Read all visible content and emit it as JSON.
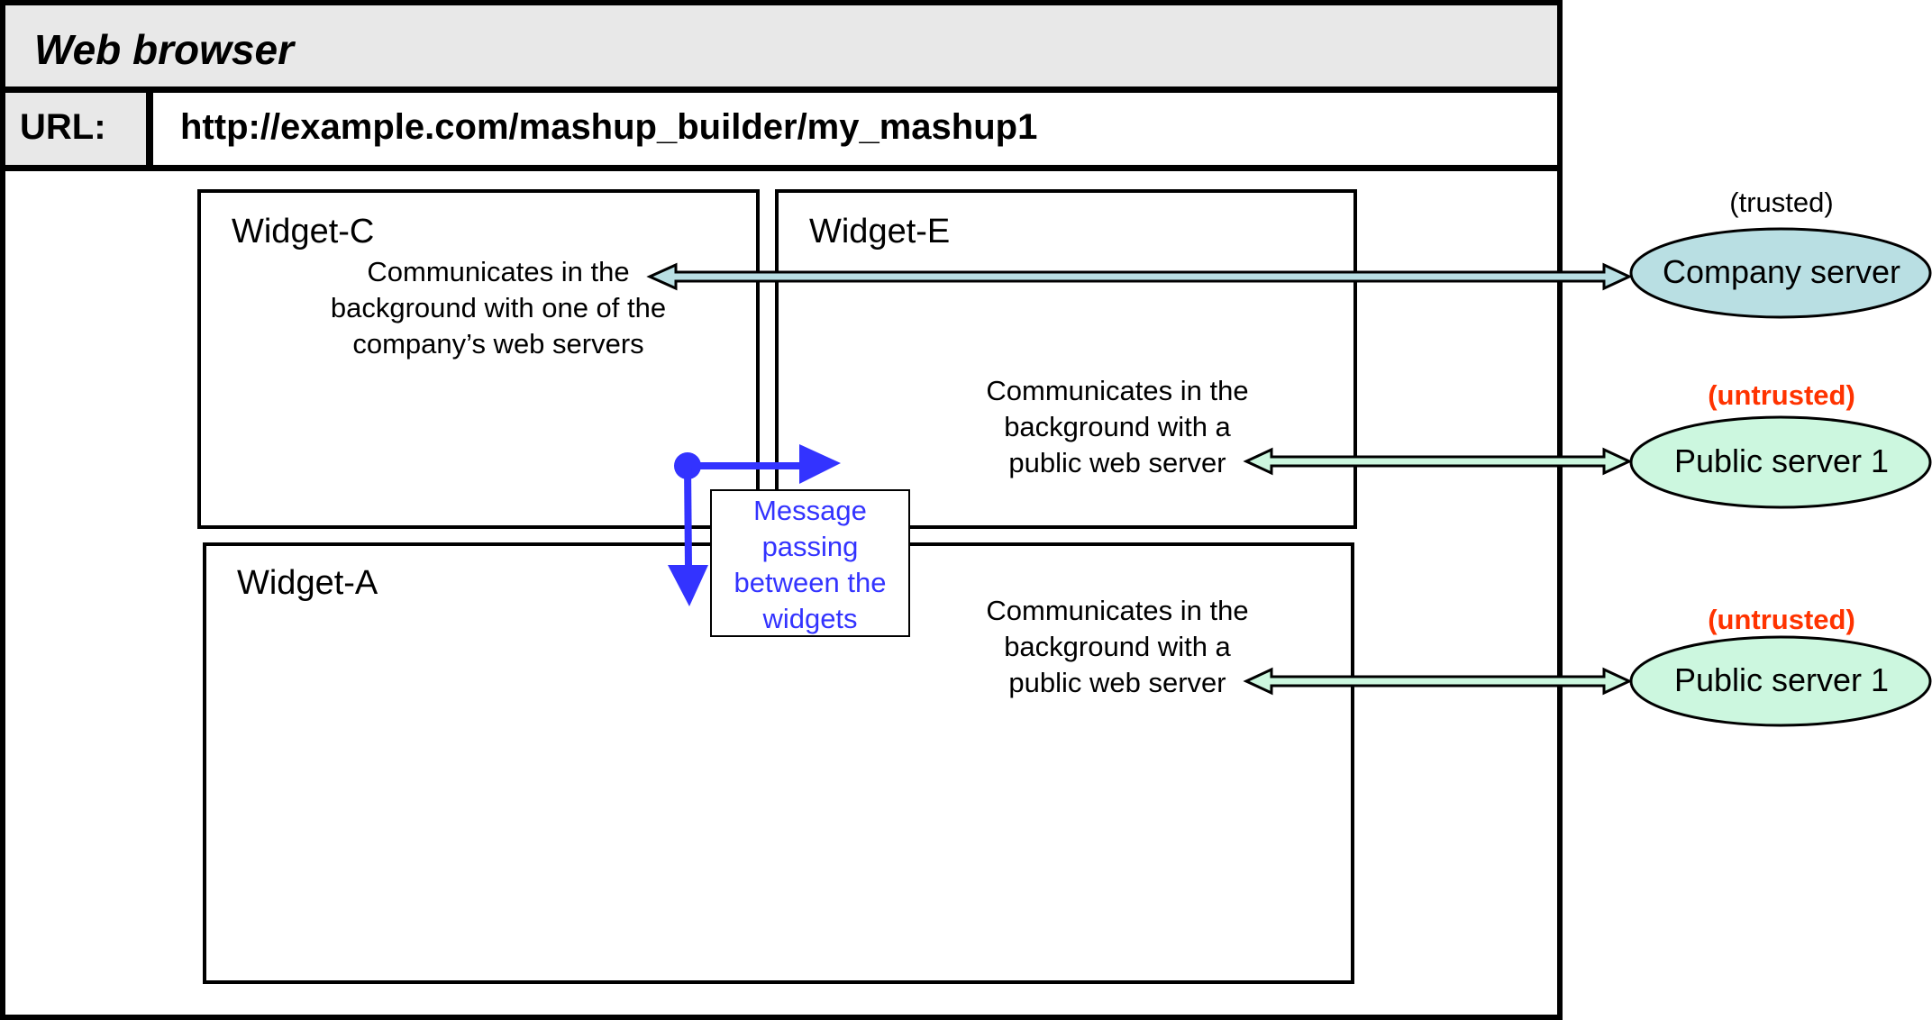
{
  "browser": {
    "title": "Web browser",
    "url_label": "URL:",
    "url_value": "http://example.com/mashup_builder/my_mashup1"
  },
  "widgets": [
    {
      "id": "widget-c",
      "title": "Widget-C",
      "description": [
        "Communicates in the",
        "background with one of the",
        "company’s web servers"
      ]
    },
    {
      "id": "widget-e",
      "title": "Widget-E",
      "description": [
        "Communicates in the",
        "background with a",
        "public web server"
      ]
    },
    {
      "id": "widget-a",
      "title": "Widget-A",
      "description": [
        "Communicates in the",
        "background with a",
        "public web server"
      ]
    }
  ],
  "message_passing": {
    "label": [
      "Message",
      "passing",
      "between the",
      "widgets"
    ],
    "color": "#3333ff"
  },
  "servers": [
    {
      "name": "Company server",
      "trust_label": "(trusted)",
      "trusted": true,
      "fill": "#b9dfe3"
    },
    {
      "name": "Public server 1",
      "trust_label": "(untrusted)",
      "trusted": false,
      "fill": "#ccf7df"
    },
    {
      "name": "Public server 1",
      "trust_label": "(untrusted)",
      "trusted": false,
      "fill": "#ccf7df"
    }
  ],
  "connections": [
    {
      "from": "Widget-C",
      "to": "Company server",
      "bidirectional": true,
      "fill": "#b9dfe3"
    },
    {
      "from": "Widget-E",
      "to": "Public server 1",
      "bidirectional": true,
      "fill": "#ccf7df"
    },
    {
      "from": "Widget-A",
      "to": "Public server 1",
      "bidirectional": true,
      "fill": "#ccf7df"
    }
  ],
  "colors": {
    "title_bar": "#e8e8e8",
    "untrusted_text": "#ff3300",
    "message_arrow": "#3333ff"
  }
}
